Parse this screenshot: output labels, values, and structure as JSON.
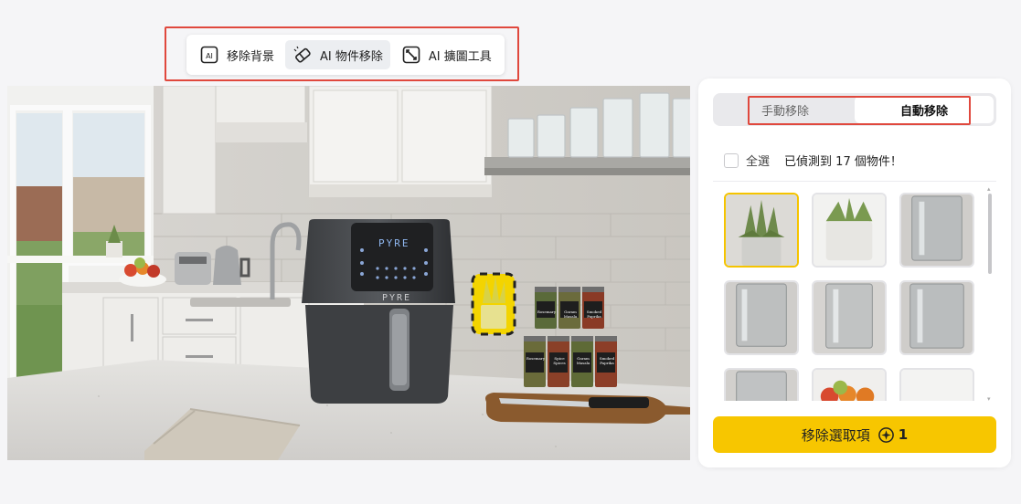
{
  "toolbar": {
    "tools": [
      {
        "label": "移除背景",
        "icon": "ai-box-icon",
        "active": false
      },
      {
        "label": "AI 物件移除",
        "icon": "eraser-icon",
        "active": true
      },
      {
        "label": "AI 擴圖工具",
        "icon": "expand-icon",
        "active": false
      }
    ]
  },
  "canvas": {
    "airfryer_brand": "PYRE",
    "airfryer_display": "PYRE",
    "spice_labels": [
      "Rosemary",
      "Garam Masala",
      "Smoked Paprika",
      "Rosemary",
      "Spice Spices",
      "Garam Masala",
      "Smoked Paprika"
    ]
  },
  "panel": {
    "mode_tabs": [
      {
        "label": "手動移除",
        "active": false
      },
      {
        "label": "自動移除",
        "active": true
      }
    ],
    "select_all_label": "全選",
    "detected_prefix": "已偵測到",
    "detected_count": "17",
    "detected_suffix": "個物件！",
    "remove_button_label": "移除選取項",
    "credit_cost": "1"
  },
  "colors": {
    "accent_yellow": "#f7c600",
    "highlight_red": "#e0483d",
    "selected_border": "#f5c400"
  }
}
